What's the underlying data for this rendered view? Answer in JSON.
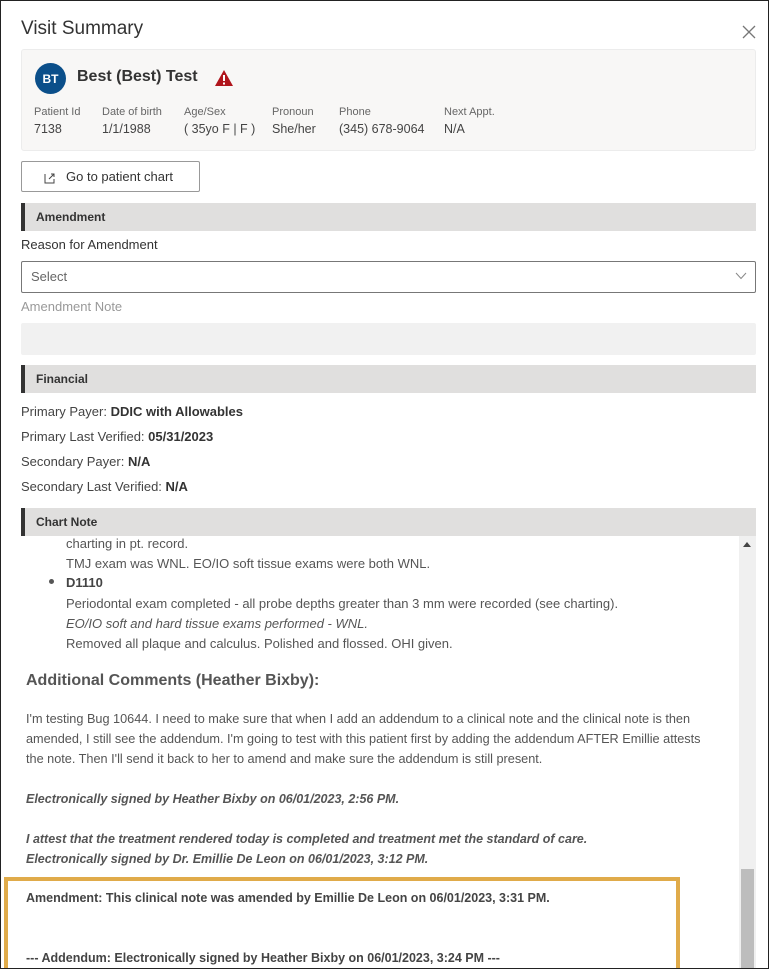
{
  "dialog": {
    "title": "Visit Summary",
    "close_icon": "close-icon"
  },
  "patient": {
    "initials": "BT",
    "name": "Best (Best) Test",
    "alert_icon": "warning-triangle-icon",
    "alert_color": "#b0151c",
    "avatar_color": "#0b4f8a",
    "fields": [
      {
        "label": "Patient Id",
        "value": "7138"
      },
      {
        "label": "Date of birth",
        "value": "1/1/1988"
      },
      {
        "label": "Age/Sex",
        "value": "( 35yo F | F )"
      },
      {
        "label": "Pronoun",
        "value": "She/her"
      },
      {
        "label": "Phone",
        "value": "(345) 678-9064"
      },
      {
        "label": "Next Appt.",
        "value": "N/A"
      }
    ]
  },
  "actions": {
    "go_to_chart": "Go to patient chart"
  },
  "amendment": {
    "section_title": "Amendment",
    "reason_label": "Reason for Amendment",
    "reason_placeholder": "Select",
    "note_label": "Amendment Note",
    "note_value": ""
  },
  "financial": {
    "section_title": "Financial",
    "rows": [
      {
        "label": "Primary Payer: ",
        "value": "DDIC with Allowables"
      },
      {
        "label": "Primary Last Verified: ",
        "value": "05/31/2023"
      },
      {
        "label": "Secondary Payer: ",
        "value": "N/A"
      },
      {
        "label": "Secondary Last Verified: ",
        "value": "N/A"
      }
    ]
  },
  "chart_note": {
    "section_title": "Chart Note",
    "lines": [
      "charting in pt. record.",
      "TMJ exam was WNL. EO/IO soft tissue exams were both WNL.",
      "D1110",
      "Periodontal exam completed - all probe depths greater than 3 mm were recorded (see charting).",
      "EO/IO soft and hard tissue exams performed -  WNL.",
      "Removed all plaque and calculus.  Polished and flossed.  OHI given."
    ],
    "additional_heading": "Additional Comments (Heather Bixby):",
    "comments": [
      "I'm testing Bug 10644. I need to make sure that when I add an addendum to a clinical note and the clinical note is then",
      "amended, I still see the addendum. I'm going to test with this patient first by adding the addendum AFTER Emillie attests",
      "the note. Then I'll send it back to her to amend and make sure the addendum is still present."
    ],
    "signed_1": "Electronically signed by Heather Bixby on 06/01/2023, 2:56 PM.",
    "attest": "I attest that the treatment rendered today is completed and treatment met the standard of care.",
    "signed_2": "Electronically signed by Dr. Emillie De Leon on 06/01/2023, 3:12 PM.",
    "amendment_line": "Amendment: This clinical note was amended by Emillie De Leon on 06/01/2023, 3:31 PM.",
    "addendum_line": "--- Addendum: Electronically signed by Heather Bixby on 06/01/2023, 3:24 PM ---",
    "highlight_color": "#e0ab4a"
  }
}
